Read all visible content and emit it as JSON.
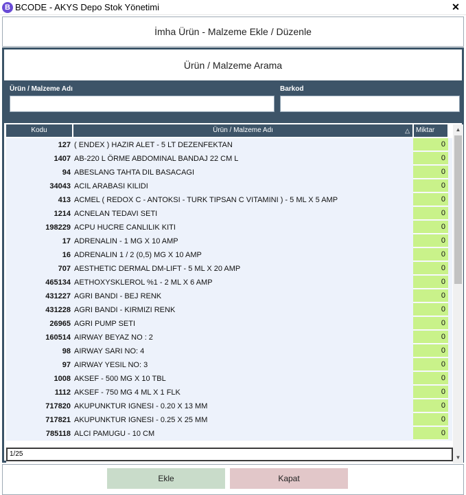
{
  "window": {
    "app_icon": "B",
    "title": "BCODE - AKYS Depo Stok Yönetimi",
    "close_glyph": "✕"
  },
  "dialog": {
    "header": "İmha Ürün - Malzeme Ekle / Düzenle"
  },
  "search": {
    "title": "Ürün / Malzeme Arama",
    "name_label": "Ürün / Malzeme Adı",
    "name_value": "",
    "barcode_label": "Barkod",
    "barcode_value": ""
  },
  "grid": {
    "columns": {
      "code": "Kodu",
      "name": "Ürün / Malzeme Adı",
      "qty": "Miktar",
      "sort_glyph": "△"
    },
    "rows": [
      {
        "code": "127",
        "name": "( ENDEX ) HAZIR ALET - 5 LT DEZENFEKTAN",
        "qty": "0"
      },
      {
        "code": "1407",
        "name": "AB-220 L  ÖRME ABDOMINAL BANDAJ 22 CM L",
        "qty": "0"
      },
      {
        "code": "94",
        "name": "ABESLANG TAHTA DIL BASACAGI",
        "qty": "0"
      },
      {
        "code": "34043",
        "name": "ACIL ARABASI KILIDI",
        "qty": "0"
      },
      {
        "code": "413",
        "name": "ACMEL ( REDOX C - ANTOKSI -  TURK TIPSAN C VITAMINI ) - 5 ML X 5 AMP",
        "qty": "0"
      },
      {
        "code": "1214",
        "name": "ACNELAN TEDAVI SETI",
        "qty": "0"
      },
      {
        "code": "198229",
        "name": "ACPU HUCRE CANLILIK KITI",
        "qty": "0"
      },
      {
        "code": "17",
        "name": "ADRENALIN - 1 MG X 10 AMP",
        "qty": "0"
      },
      {
        "code": "16",
        "name": "ADRENALIN 1 / 2 (0,5) MG X 10 AMP",
        "qty": "0"
      },
      {
        "code": "707",
        "name": "AESTHETIC DERMAL DM-LIFT - 5 ML X 20 AMP",
        "qty": "0"
      },
      {
        "code": "465134",
        "name": "AETHOXYSKLEROL %1 - 2 ML X 6 AMP",
        "qty": "0"
      },
      {
        "code": "431227",
        "name": "AGRI BANDI - BEJ RENK",
        "qty": "0"
      },
      {
        "code": "431228",
        "name": "AGRI BANDI - KIRMIZI RENK",
        "qty": "0"
      },
      {
        "code": "26965",
        "name": "AGRI PUMP SETI",
        "qty": "0"
      },
      {
        "code": "160514",
        "name": "AIRWAY BEYAZ NO : 2",
        "qty": "0"
      },
      {
        "code": "98",
        "name": "AIRWAY SARI NO: 4",
        "qty": "0"
      },
      {
        "code": "97",
        "name": "AIRWAY YESIL NO: 3",
        "qty": "0"
      },
      {
        "code": "1008",
        "name": "AKSEF - 500 MG X  10 TBL",
        "qty": "0"
      },
      {
        "code": "1112",
        "name": "AKSEF - 750 MG 4 ML X 1 FLK",
        "qty": "0"
      },
      {
        "code": "717820",
        "name": "AKUPUNKTUR IGNESI - 0.20 X 13 MM",
        "qty": "0"
      },
      {
        "code": "717821",
        "name": "AKUPUNKTUR IGNESI - 0.25 X 25 MM",
        "qty": "0"
      },
      {
        "code": "785118",
        "name": "ALCI PAMUGU - 10 CM",
        "qty": "0"
      }
    ],
    "pager": "1/25"
  },
  "scrollbar": {
    "up_glyph": "▲",
    "down_glyph": "▼"
  },
  "footer": {
    "add_label": "Ekle",
    "close_label": "Kapat"
  },
  "colors": {
    "panel": "#3d5468",
    "qty_cell": "#c9f28a",
    "row_bg": "#edf2fb",
    "add_button": "#c9dcca",
    "close_button": "#e2c7c9"
  }
}
